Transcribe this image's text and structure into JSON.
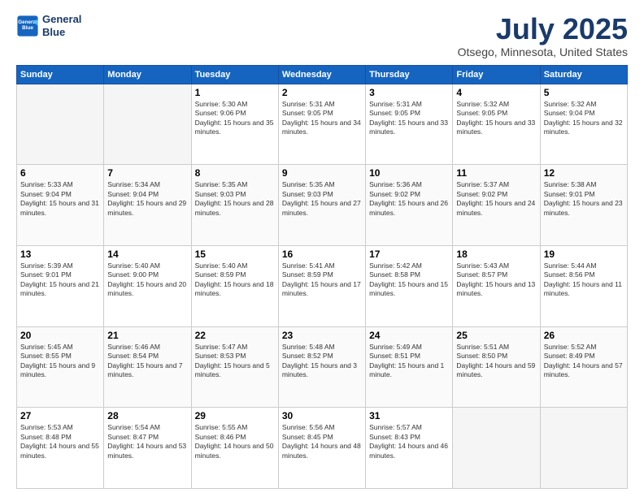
{
  "header": {
    "logo_line1": "General",
    "logo_line2": "Blue",
    "title": "July 2025",
    "location": "Otsego, Minnesota, United States"
  },
  "weekdays": [
    "Sunday",
    "Monday",
    "Tuesday",
    "Wednesday",
    "Thursday",
    "Friday",
    "Saturday"
  ],
  "weeks": [
    [
      {
        "day": "",
        "empty": true
      },
      {
        "day": "",
        "empty": true
      },
      {
        "day": "1",
        "sunrise": "Sunrise: 5:30 AM",
        "sunset": "Sunset: 9:06 PM",
        "daylight": "Daylight: 15 hours and 35 minutes."
      },
      {
        "day": "2",
        "sunrise": "Sunrise: 5:31 AM",
        "sunset": "Sunset: 9:05 PM",
        "daylight": "Daylight: 15 hours and 34 minutes."
      },
      {
        "day": "3",
        "sunrise": "Sunrise: 5:31 AM",
        "sunset": "Sunset: 9:05 PM",
        "daylight": "Daylight: 15 hours and 33 minutes."
      },
      {
        "day": "4",
        "sunrise": "Sunrise: 5:32 AM",
        "sunset": "Sunset: 9:05 PM",
        "daylight": "Daylight: 15 hours and 33 minutes."
      },
      {
        "day": "5",
        "sunrise": "Sunrise: 5:32 AM",
        "sunset": "Sunset: 9:04 PM",
        "daylight": "Daylight: 15 hours and 32 minutes."
      }
    ],
    [
      {
        "day": "6",
        "sunrise": "Sunrise: 5:33 AM",
        "sunset": "Sunset: 9:04 PM",
        "daylight": "Daylight: 15 hours and 31 minutes."
      },
      {
        "day": "7",
        "sunrise": "Sunrise: 5:34 AM",
        "sunset": "Sunset: 9:04 PM",
        "daylight": "Daylight: 15 hours and 29 minutes."
      },
      {
        "day": "8",
        "sunrise": "Sunrise: 5:35 AM",
        "sunset": "Sunset: 9:03 PM",
        "daylight": "Daylight: 15 hours and 28 minutes."
      },
      {
        "day": "9",
        "sunrise": "Sunrise: 5:35 AM",
        "sunset": "Sunset: 9:03 PM",
        "daylight": "Daylight: 15 hours and 27 minutes."
      },
      {
        "day": "10",
        "sunrise": "Sunrise: 5:36 AM",
        "sunset": "Sunset: 9:02 PM",
        "daylight": "Daylight: 15 hours and 26 minutes."
      },
      {
        "day": "11",
        "sunrise": "Sunrise: 5:37 AM",
        "sunset": "Sunset: 9:02 PM",
        "daylight": "Daylight: 15 hours and 24 minutes."
      },
      {
        "day": "12",
        "sunrise": "Sunrise: 5:38 AM",
        "sunset": "Sunset: 9:01 PM",
        "daylight": "Daylight: 15 hours and 23 minutes."
      }
    ],
    [
      {
        "day": "13",
        "sunrise": "Sunrise: 5:39 AM",
        "sunset": "Sunset: 9:01 PM",
        "daylight": "Daylight: 15 hours and 21 minutes."
      },
      {
        "day": "14",
        "sunrise": "Sunrise: 5:40 AM",
        "sunset": "Sunset: 9:00 PM",
        "daylight": "Daylight: 15 hours and 20 minutes."
      },
      {
        "day": "15",
        "sunrise": "Sunrise: 5:40 AM",
        "sunset": "Sunset: 8:59 PM",
        "daylight": "Daylight: 15 hours and 18 minutes."
      },
      {
        "day": "16",
        "sunrise": "Sunrise: 5:41 AM",
        "sunset": "Sunset: 8:59 PM",
        "daylight": "Daylight: 15 hours and 17 minutes."
      },
      {
        "day": "17",
        "sunrise": "Sunrise: 5:42 AM",
        "sunset": "Sunset: 8:58 PM",
        "daylight": "Daylight: 15 hours and 15 minutes."
      },
      {
        "day": "18",
        "sunrise": "Sunrise: 5:43 AM",
        "sunset": "Sunset: 8:57 PM",
        "daylight": "Daylight: 15 hours and 13 minutes."
      },
      {
        "day": "19",
        "sunrise": "Sunrise: 5:44 AM",
        "sunset": "Sunset: 8:56 PM",
        "daylight": "Daylight: 15 hours and 11 minutes."
      }
    ],
    [
      {
        "day": "20",
        "sunrise": "Sunrise: 5:45 AM",
        "sunset": "Sunset: 8:55 PM",
        "daylight": "Daylight: 15 hours and 9 minutes."
      },
      {
        "day": "21",
        "sunrise": "Sunrise: 5:46 AM",
        "sunset": "Sunset: 8:54 PM",
        "daylight": "Daylight: 15 hours and 7 minutes."
      },
      {
        "day": "22",
        "sunrise": "Sunrise: 5:47 AM",
        "sunset": "Sunset: 8:53 PM",
        "daylight": "Daylight: 15 hours and 5 minutes."
      },
      {
        "day": "23",
        "sunrise": "Sunrise: 5:48 AM",
        "sunset": "Sunset: 8:52 PM",
        "daylight": "Daylight: 15 hours and 3 minutes."
      },
      {
        "day": "24",
        "sunrise": "Sunrise: 5:49 AM",
        "sunset": "Sunset: 8:51 PM",
        "daylight": "Daylight: 15 hours and 1 minute."
      },
      {
        "day": "25",
        "sunrise": "Sunrise: 5:51 AM",
        "sunset": "Sunset: 8:50 PM",
        "daylight": "Daylight: 14 hours and 59 minutes."
      },
      {
        "day": "26",
        "sunrise": "Sunrise: 5:52 AM",
        "sunset": "Sunset: 8:49 PM",
        "daylight": "Daylight: 14 hours and 57 minutes."
      }
    ],
    [
      {
        "day": "27",
        "sunrise": "Sunrise: 5:53 AM",
        "sunset": "Sunset: 8:48 PM",
        "daylight": "Daylight: 14 hours and 55 minutes."
      },
      {
        "day": "28",
        "sunrise": "Sunrise: 5:54 AM",
        "sunset": "Sunset: 8:47 PM",
        "daylight": "Daylight: 14 hours and 53 minutes."
      },
      {
        "day": "29",
        "sunrise": "Sunrise: 5:55 AM",
        "sunset": "Sunset: 8:46 PM",
        "daylight": "Daylight: 14 hours and 50 minutes."
      },
      {
        "day": "30",
        "sunrise": "Sunrise: 5:56 AM",
        "sunset": "Sunset: 8:45 PM",
        "daylight": "Daylight: 14 hours and 48 minutes."
      },
      {
        "day": "31",
        "sunrise": "Sunrise: 5:57 AM",
        "sunset": "Sunset: 8:43 PM",
        "daylight": "Daylight: 14 hours and 46 minutes."
      },
      {
        "day": "",
        "empty": true
      },
      {
        "day": "",
        "empty": true
      }
    ]
  ]
}
